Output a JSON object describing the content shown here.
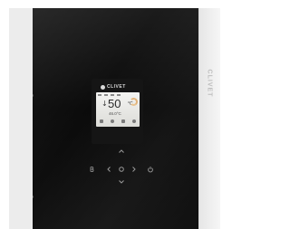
{
  "device": {
    "brand": "CLIVET",
    "side_brand": "CLIVET"
  },
  "display": {
    "main_value": "50",
    "main_unit": "°C",
    "secondary_value": "46.0°C"
  },
  "keys": [
    {
      "name": "menu-key",
      "icon": "b-icon"
    },
    {
      "name": "left-key",
      "icon": "chevron-left-icon"
    },
    {
      "name": "ok-key",
      "icon": "ok-dot-icon"
    },
    {
      "name": "right-key",
      "icon": "chevron-right-icon"
    },
    {
      "name": "power-key",
      "icon": "power-icon"
    },
    {
      "name": "up-key",
      "icon": "chevron-up-icon"
    },
    {
      "name": "down-key",
      "icon": "chevron-down-icon"
    }
  ],
  "colors": {
    "panel_black": "#0b0b0b",
    "screen_background": "#e8e8e6",
    "accent_orange": "#e2b37a"
  }
}
